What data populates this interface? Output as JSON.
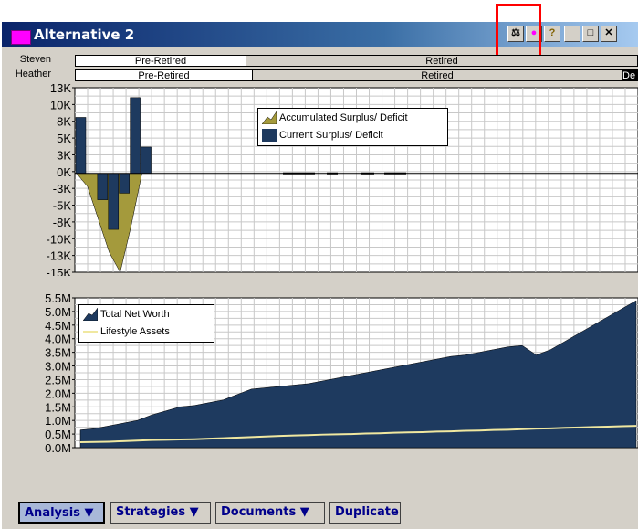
{
  "window": {
    "title": "Alternative 2"
  },
  "title_buttons": {
    "scales": "⚖",
    "prefs": "●",
    "help": "?",
    "minimize": "_",
    "maximize": "□",
    "close": "✕"
  },
  "timeline": {
    "people": [
      {
        "name": "Steven",
        "phases": [
          "Pre-Retired",
          "Retired"
        ]
      },
      {
        "name": "Heather",
        "phases": [
          "Pre-Retired",
          "Retired",
          "De"
        ]
      }
    ]
  },
  "chart_data": [
    {
      "type": "bar",
      "y_ticks": [
        "13K",
        "10K",
        "8K",
        "5K",
        "3K",
        "0K",
        "-3K",
        "-5K",
        "-8K",
        "-10K",
        "-13K",
        "-15K"
      ],
      "ylim": [
        -15000,
        13000
      ],
      "legend": [
        "Accumulated Surplus/ Deficit",
        "Current Surplus/ Deficit"
      ],
      "colors": {
        "accumulated": "#a49a3c",
        "current": "#1e3a5f"
      },
      "series": [
        {
          "name": "Current Surplus/ Deficit",
          "values": [
            8500,
            0,
            -4000,
            -8500,
            -3000,
            11500,
            4000
          ]
        },
        {
          "name": "Accumulated Surplus/ Deficit",
          "values": [
            0,
            -2000,
            -7000,
            -12000,
            -15000,
            -8000,
            0
          ]
        }
      ]
    },
    {
      "type": "area",
      "y_ticks": [
        "5.5M",
        "5.0M",
        "4.5M",
        "4.0M",
        "3.5M",
        "3.0M",
        "2.5M",
        "2.0M",
        "1.5M",
        "1.0M",
        "0.5M",
        "0.0M"
      ],
      "ylim": [
        0,
        5.5
      ],
      "legend": [
        "Total Net Worth",
        "Lifestyle Assets"
      ],
      "colors": {
        "net_worth": "#1e3a5f",
        "lifestyle": "#f0e8a0"
      },
      "series": [
        {
          "name": "Total Net Worth",
          "values": [
            0.65,
            0.7,
            0.8,
            0.9,
            1.0,
            1.2,
            1.35,
            1.5,
            1.55,
            1.65,
            1.75,
            1.95,
            2.15,
            2.2,
            2.25,
            2.3,
            2.35,
            2.45,
            2.55,
            2.65,
            2.75,
            2.85,
            2.95,
            3.05,
            3.15,
            3.25,
            3.35,
            3.4,
            3.5,
            3.6,
            3.7,
            3.75,
            3.4,
            3.6,
            3.9,
            4.2,
            4.5,
            4.8,
            5.1,
            5.4
          ]
        },
        {
          "name": "Lifestyle Assets",
          "values": [
            0.2,
            0.21,
            0.22,
            0.24,
            0.26,
            0.28,
            0.29,
            0.3,
            0.31,
            0.33,
            0.35,
            0.37,
            0.39,
            0.41,
            0.43,
            0.45,
            0.46,
            0.48,
            0.49,
            0.5,
            0.52,
            0.53,
            0.55,
            0.56,
            0.57,
            0.59,
            0.6,
            0.62,
            0.63,
            0.65,
            0.66,
            0.68,
            0.7,
            0.71,
            0.73,
            0.74,
            0.76,
            0.77,
            0.79,
            0.8
          ]
        }
      ]
    }
  ],
  "toolbar": {
    "analysis": "Analysis ▼",
    "strategies": "Strategies ▼",
    "documents": "Documents ▼",
    "duplicate": "Duplicate"
  }
}
